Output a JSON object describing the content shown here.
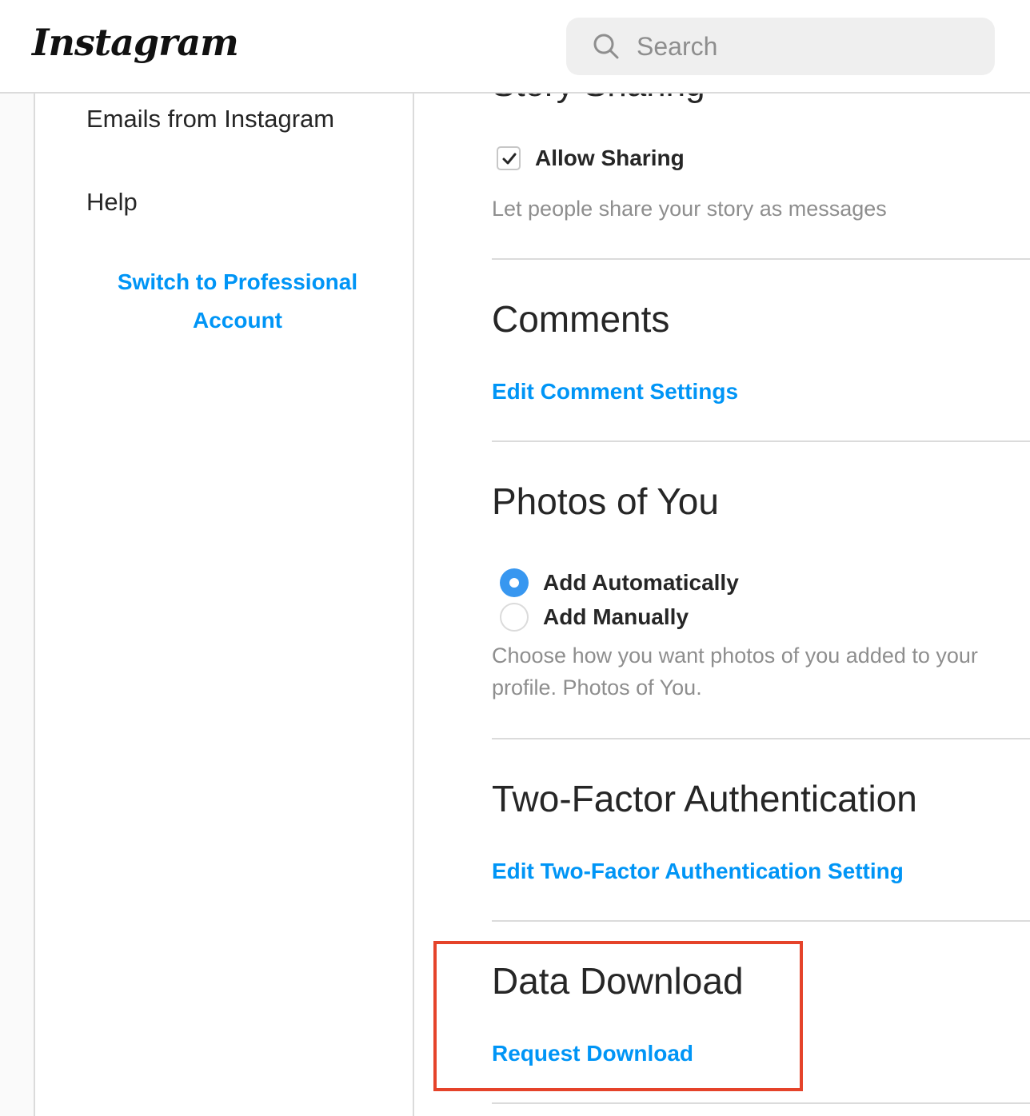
{
  "header": {
    "logo_text": "Instagram",
    "search_placeholder": "Search"
  },
  "sidebar": {
    "items": [
      {
        "label": "Emails from Instagram"
      },
      {
        "label": "Help"
      }
    ],
    "switch_professional": "Switch to Professional Account"
  },
  "story_sharing": {
    "title": "Story Sharing",
    "checkbox_label": "Allow Sharing",
    "checked": true,
    "help": "Let people share your story as messages"
  },
  "comments": {
    "title": "Comments",
    "link": "Edit Comment Settings"
  },
  "photos_of_you": {
    "title": "Photos of You",
    "options": [
      {
        "label": "Add Automatically",
        "selected": true
      },
      {
        "label": "Add Manually",
        "selected": false
      }
    ],
    "help": "Choose how you want photos of you added to your profile. Photos of You."
  },
  "two_factor": {
    "title": "Two-Factor Authentication",
    "link": "Edit Two-Factor Authentication Setting"
  },
  "data_download": {
    "title": "Data Download",
    "link": "Request Download"
  },
  "colors": {
    "accent": "#0095f6",
    "highlight": "#e5432a",
    "radio_selected": "#3897f0"
  }
}
